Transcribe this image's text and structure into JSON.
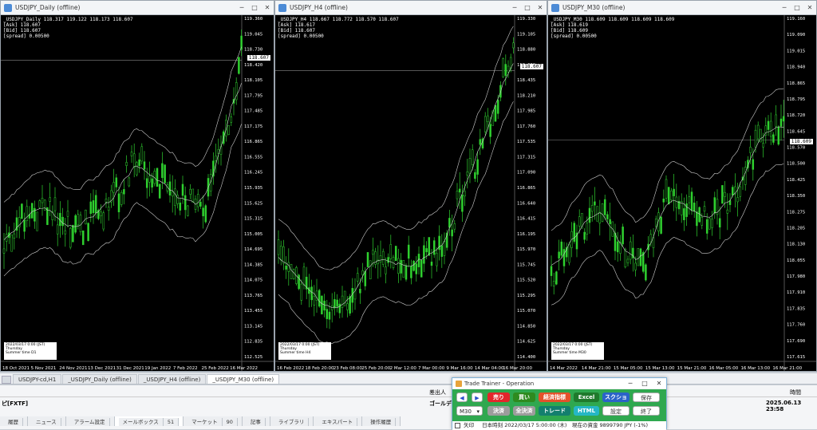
{
  "windows": [
    {
      "title": "USDJPY_Daily (offline)",
      "info": [
        "_USDJPY_Daily 118.317 119.122 118.173 118.607",
        "[Ask] 118.607",
        "[Bid] 118.607",
        "[spread] 0.00500"
      ],
      "current_price": "118.607",
      "y_labels": [
        "119.360",
        "119.045",
        "118.730",
        "118.420",
        "118.105",
        "117.795",
        "117.485",
        "117.175",
        "116.865",
        "116.555",
        "116.245",
        "115.935",
        "115.625",
        "115.315",
        "115.005",
        "114.695",
        "114.385",
        "114.075",
        "113.765",
        "113.455",
        "113.145",
        "112.835",
        "112.525"
      ],
      "x_labels": [
        "18 Oct 2021",
        "5 Nov 2021",
        "24 Nov 2021",
        "13 Dec 2021",
        "31 Dec 2021",
        "19 Jan 2022",
        "7 Feb 2022",
        "25 Feb 2022",
        "16 Mar 2022"
      ],
      "panel": [
        "2022/03/17 0:00 (JST)",
        "Thursday",
        "Summer time   D1"
      ]
    },
    {
      "title": "USDJPY_H4 (offline)",
      "info": [
        "_USDJPY_H4 118.667 118.772 118.570 118.607",
        "[Ask] 118.617",
        "[Bid] 118.607",
        "[spread] 0.00500"
      ],
      "current_price": "118.607",
      "y_labels": [
        "119.330",
        "119.105",
        "118.880",
        "118.660",
        "118.435",
        "118.210",
        "117.985",
        "117.760",
        "117.535",
        "117.315",
        "117.090",
        "116.865",
        "116.640",
        "116.415",
        "116.195",
        "115.970",
        "115.745",
        "115.520",
        "115.295",
        "115.070",
        "114.850",
        "114.625",
        "114.400"
      ],
      "x_labels": [
        "16 Feb 2022",
        "18 Feb 20:00",
        "23 Feb 08:00",
        "25 Feb 20:00",
        "2 Mar 12:00",
        "7 Mar 00:00",
        "9 Mar 16:00",
        "14 Mar 04:00",
        "16 Mar 20:00"
      ],
      "panel": [
        "2022/03/17 0:00 (JST)",
        "Thursday",
        "Summer time   H4"
      ]
    },
    {
      "title": "USDJPY_M30 (offline)",
      "info": [
        "_USDJPY_M30 118.609 118.609 118.609 118.609",
        "[Ask] 118.619",
        "[Bid] 118.609",
        "[spread] 0.00500"
      ],
      "current_price": "118.609",
      "y_labels": [
        "119.160",
        "119.090",
        "119.015",
        "118.940",
        "118.865",
        "118.795",
        "118.720",
        "118.645",
        "118.570",
        "118.500",
        "118.425",
        "118.350",
        "118.275",
        "118.205",
        "118.130",
        "118.055",
        "117.980",
        "117.910",
        "117.835",
        "117.760",
        "117.690",
        "117.615"
      ],
      "x_labels": [
        "14 Mar 2022",
        "14 Mar 21:00",
        "15 Mar 05:00",
        "15 Mar 13:00",
        "15 Mar 21:00",
        "16 Mar 05:00",
        "16 Mar 13:00",
        "16 Mar 21:00"
      ],
      "panel": [
        "2022/03/17 0:00 (JST)",
        "Thursday",
        "Summer time   M30"
      ]
    }
  ],
  "chart_tabs": [
    "USDJPY-cd,H1",
    "_USDJPY_Daily (offline)",
    "_USDJPY_H4 (offline)",
    "_USDJPY_M30 (offline)"
  ],
  "toolbox": {
    "col_left": "差出人",
    "col_right": "時間",
    "sender": "ゴールデンウェイジャパン",
    "time": "2025.06.13 23:58",
    "left_label": "ピ[FXTF]"
  },
  "bottom_tabs": [
    {
      "label": "履歴",
      "badge": ""
    },
    {
      "label": "ニュース",
      "badge": ""
    },
    {
      "label": "アラーム設定",
      "badge": ""
    },
    {
      "label": "メールボックス",
      "badge": "51"
    },
    {
      "label": "マーケット",
      "badge": "90"
    },
    {
      "label": "記事",
      "badge": ""
    },
    {
      "label": "ライブラリ",
      "badge": ""
    },
    {
      "label": "エキスパート",
      "badge": ""
    },
    {
      "label": "操作履歴",
      "badge": ""
    }
  ],
  "dialog": {
    "title": "Trade Trainer - Operation",
    "sell": "売り",
    "buy": "買い",
    "indicators": "経済指標",
    "excel": "Excel",
    "screenshot": "スクショ",
    "save": "保存",
    "timeframe": "M30",
    "settle": "決済",
    "settle_all": "全決済",
    "trade": "トレード",
    "html": "HTML",
    "settings": "設定",
    "exit": "終了",
    "arrow_checkbox": "矢印",
    "status": "日本時刻 2022/03/17 5:00:00 (木)　現在の資金 9899790 JPY (-1%)",
    "colors": {
      "sell": "#e3262b",
      "buy": "#2e8b1f",
      "indicators": "#e5512a",
      "excel": "#1f7a2c",
      "screenshot": "#2a63c8",
      "trade": "#137f6e",
      "html": "#25b7c5",
      "grey": "#9c9c9c"
    }
  },
  "icons": [
    "chevron-left-icon",
    "chevron-right-icon",
    "window-icon",
    "minimize-icon",
    "maximize-icon",
    "close-icon"
  ]
}
